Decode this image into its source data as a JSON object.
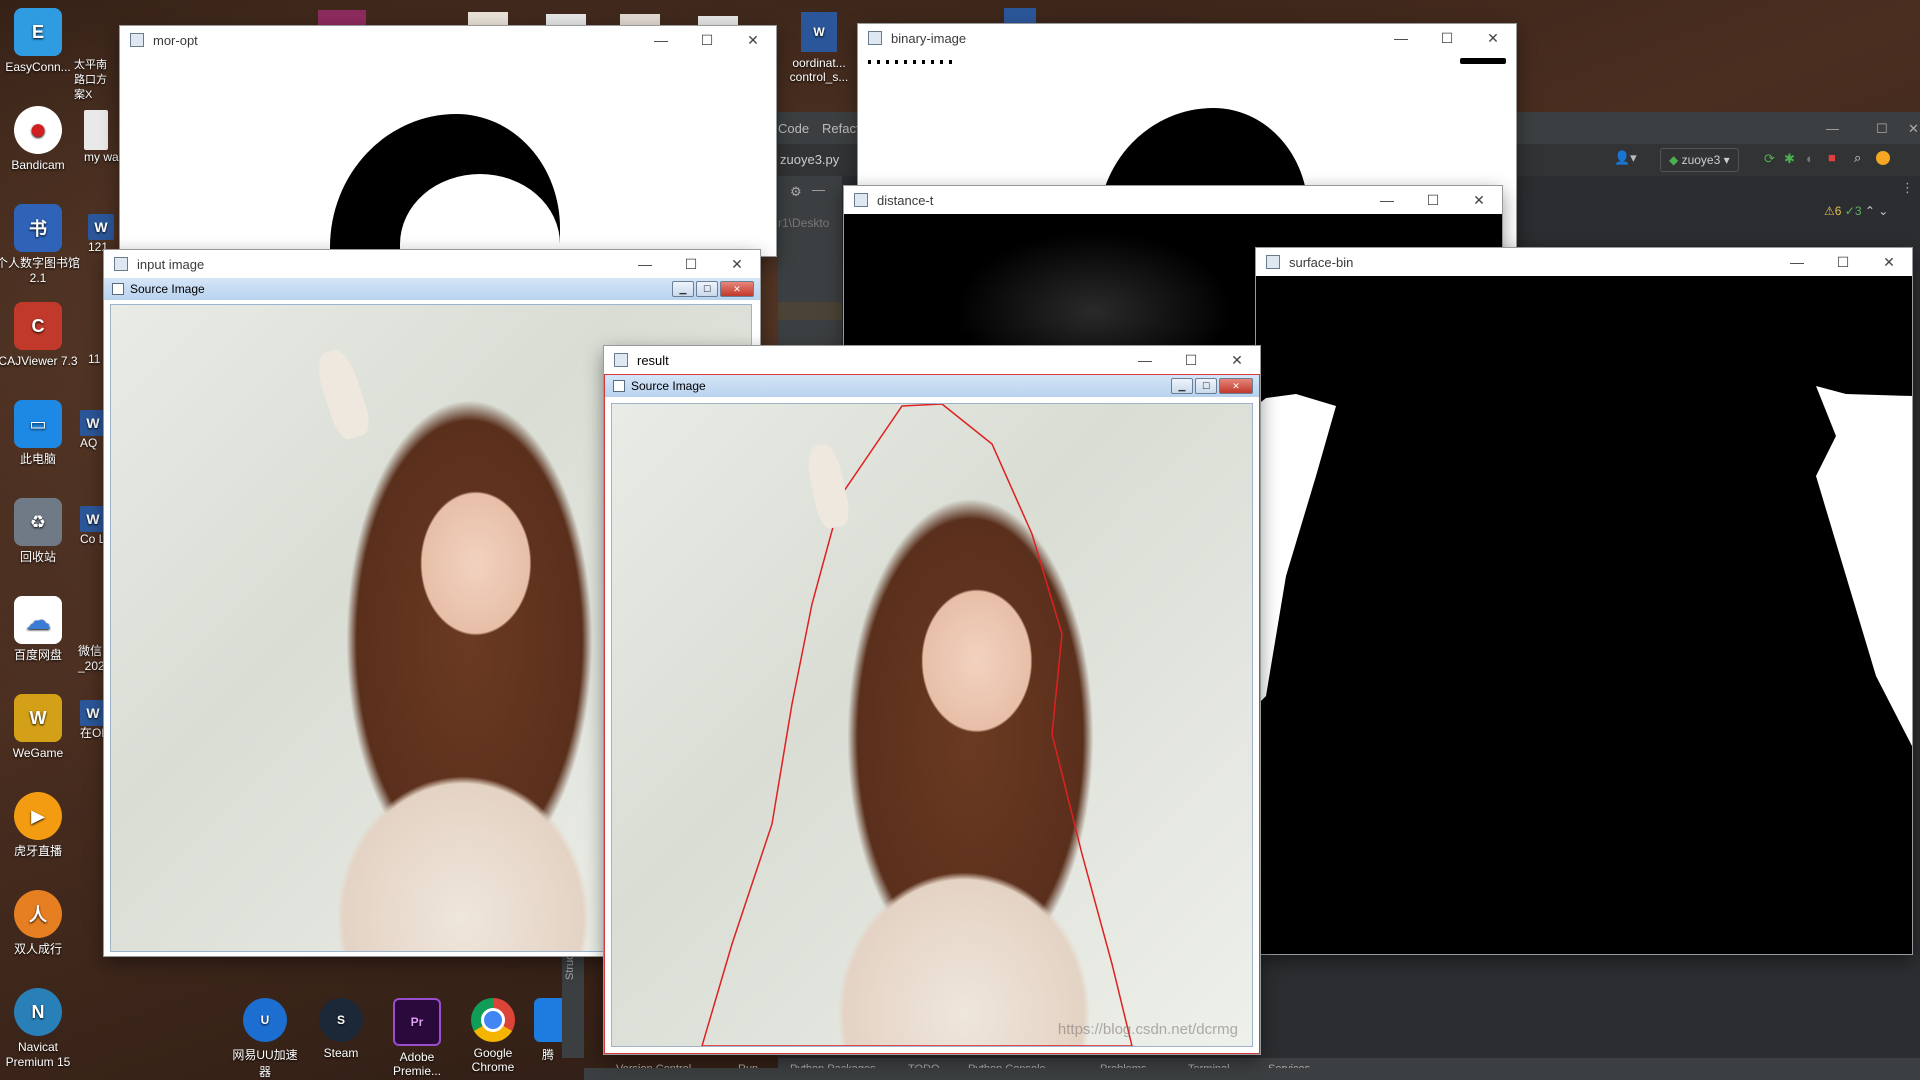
{
  "desktop": {
    "icons": [
      {
        "label": "EasyConn...",
        "color": "#2f9be0",
        "glyph": "E"
      },
      {
        "label": "Bandicam",
        "color": "#d11f1f",
        "glyph": "●"
      },
      {
        "label": "个人数字图书馆2.1",
        "color": "#2e63b8",
        "glyph": "书"
      },
      {
        "label": "CAJViewer 7.3",
        "color": "#c0392b",
        "glyph": "C"
      },
      {
        "label": "此电脑",
        "color": "#1e88e5",
        "glyph": "▭"
      },
      {
        "label": "回收站",
        "color": "#6f7a86",
        "glyph": "♻"
      },
      {
        "label": "百度网盘",
        "color": "#3a7bd5",
        "glyph": "☁"
      },
      {
        "label": "WeGame",
        "color": "#d4a017",
        "glyph": "W"
      },
      {
        "label": "虎牙直播",
        "color": "#f39c12",
        "glyph": "▶"
      },
      {
        "label": "双人成行",
        "color": "#e67e22",
        "glyph": "人"
      },
      {
        "label": "Navicat Premium 15",
        "color": "#2980b9",
        "glyph": "N"
      }
    ],
    "partial_labels": [
      "太平南路口方案X",
      "my wa",
      "121",
      "11",
      "AQ",
      "Co Lis",
      "微信_202",
      "在OD"
    ]
  },
  "taskbar_icons": [
    {
      "label": "网易UU加速器",
      "color": "#1c6fd1",
      "glyph": "U"
    },
    {
      "label": "Steam",
      "color": "#1b2838",
      "glyph": "S"
    },
    {
      "label": "Adobe Premie...",
      "color": "#2a0a3c",
      "glyph": "Pr"
    },
    {
      "label": "Google Chrome",
      "color": "#db4437",
      "glyph": "◉"
    },
    {
      "label": "腾",
      "color": "#1e7be0",
      "glyph": "腾"
    }
  ],
  "partial_desktop": {
    "file_label": "oordinat... control_s..."
  },
  "ide": {
    "menu": {
      "code": "Code",
      "refactor": "Refact"
    },
    "file_tab": "zuoye3.py",
    "path_hint": "r1\\Deskto",
    "run_config": "zuoye3",
    "inspections": {
      "warnings": "⚠6",
      "ok": "✓3"
    },
    "bottom_tabs": [
      "Version Control",
      "Run",
      "Python Packages",
      "TODO",
      "Python Console",
      "Problems",
      "Terminal",
      "Services"
    ],
    "structure_label": "Structure"
  },
  "windows": {
    "mor_opt": {
      "title": "mor-opt"
    },
    "binary_image": {
      "title": "binary-image"
    },
    "distance_t": {
      "title": "distance-t"
    },
    "surface_bin": {
      "title": "surface-bin"
    },
    "input_image": {
      "title": "input image",
      "inner_title": "Source Image"
    },
    "result": {
      "title": "result",
      "inner_title": "Source Image",
      "watermark": "https://blog.csdn.net/dcrmg"
    }
  },
  "window_controls": {
    "minimize": "—",
    "maximize": "☐",
    "close": "✕"
  }
}
